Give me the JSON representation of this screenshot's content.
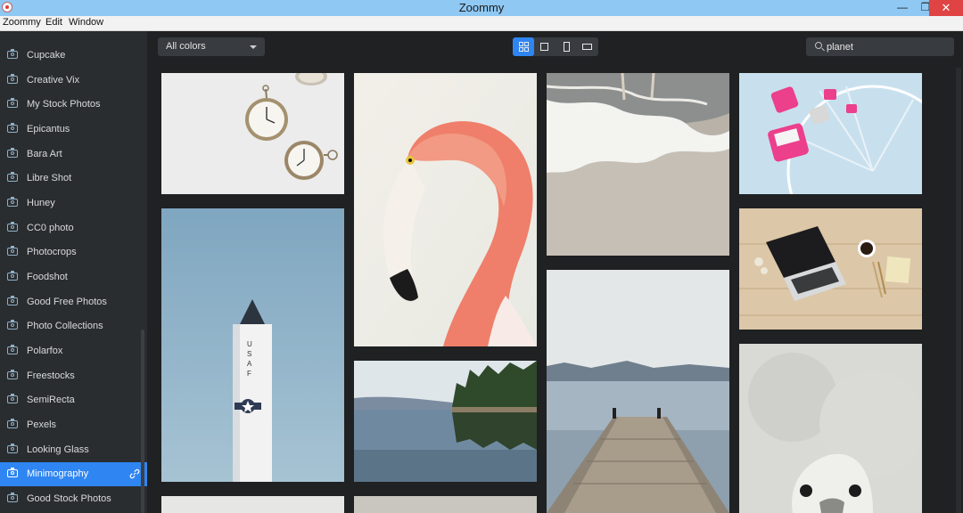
{
  "window": {
    "title": "Zoommy",
    "minimize": "—",
    "maximize": "❐",
    "close": "✕"
  },
  "menu": [
    "Zoommy",
    "Edit",
    "Window"
  ],
  "sidebar": {
    "items": [
      {
        "label": "Cupcake"
      },
      {
        "label": "Creative Vix"
      },
      {
        "label": "My Stock Photos"
      },
      {
        "label": "Epicantus"
      },
      {
        "label": "Bara Art"
      },
      {
        "label": "Libre Shot"
      },
      {
        "label": "Huney"
      },
      {
        "label": "CC0 photo"
      },
      {
        "label": "Photocrops"
      },
      {
        "label": "Foodshot"
      },
      {
        "label": "Good Free Photos"
      },
      {
        "label": "Photo Collections"
      },
      {
        "label": "Polarfox"
      },
      {
        "label": "Freestocks"
      },
      {
        "label": "SemiRecta"
      },
      {
        "label": "Pexels"
      },
      {
        "label": "Looking Glass"
      },
      {
        "label": "Minimography",
        "active": true
      },
      {
        "label": "Good Stock Photos"
      }
    ],
    "accent": "#2f86f2"
  },
  "toolbar": {
    "color_filter": "All colors",
    "view_modes": [
      "grid",
      "large",
      "portrait",
      "landscape"
    ],
    "active_view": "grid"
  },
  "search": {
    "value": "planet"
  },
  "gallery": {
    "photos": [
      {
        "subject": "pocket-watches"
      },
      {
        "subject": "flamingo"
      },
      {
        "subject": "beach-waves"
      },
      {
        "subject": "ferris-wheel"
      },
      {
        "subject": "rocket"
      },
      {
        "subject": "laptop-desk"
      },
      {
        "subject": "lake-forest"
      },
      {
        "subject": "pier"
      },
      {
        "subject": "ostrich"
      }
    ]
  },
  "colors": {
    "background": "#1f2123",
    "sidebar": "#2a2d30",
    "titlebar": "#8fc8f3"
  }
}
